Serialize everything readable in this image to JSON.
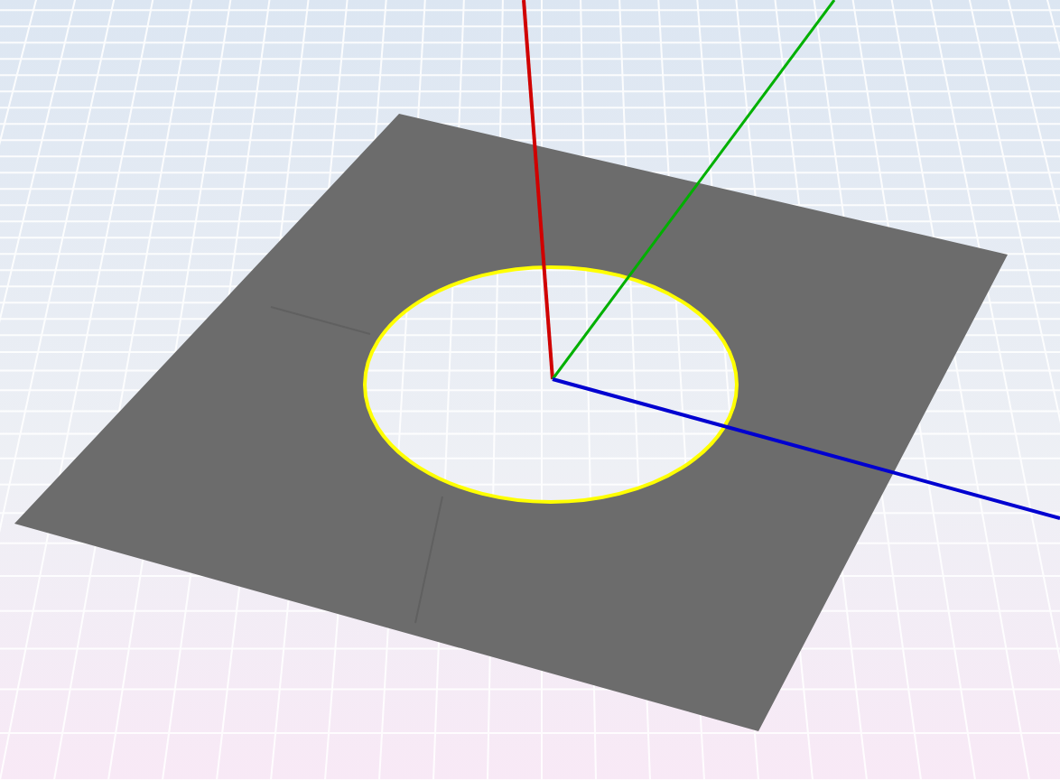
{
  "viewport": {
    "hole_edge": {
      "selected": true
    }
  }
}
